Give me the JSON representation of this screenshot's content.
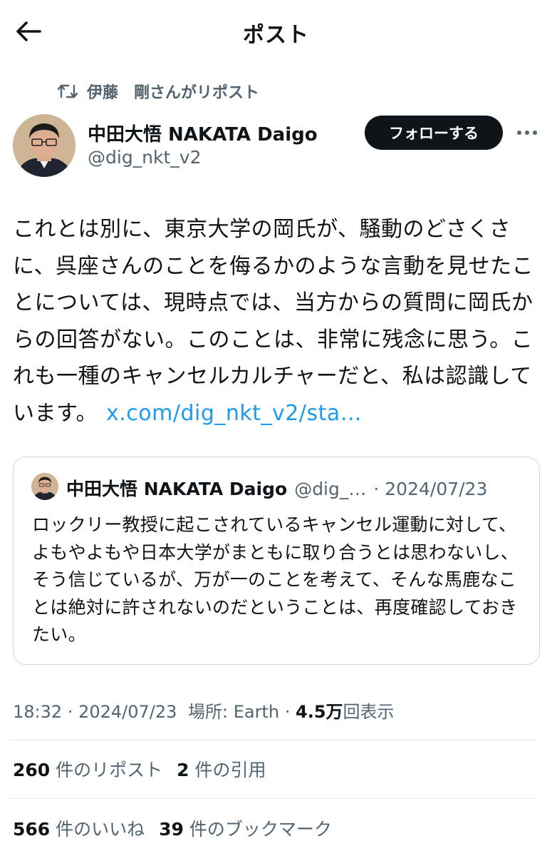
{
  "header": {
    "title": "ポスト"
  },
  "repost": {
    "label": "伊藤　剛さんがリポスト"
  },
  "author": {
    "name": "中田大悟 NAKATA Daigo",
    "handle": "@dig_nkt_v2",
    "follow_label": "フォローする"
  },
  "post": {
    "text": "これとは別に、東京大学の岡氏が、騒動のどさくさに、呉座さんのことを侮るかのような言動を見せたことについては、現時点では、当方からの質問に岡氏からの回答がない。このことは、非常に残念に思う。これも一種のキャンセルカルチャーだと、私は認識しています。",
    "link": "x.com/dig_nkt_v2/sta…"
  },
  "quote": {
    "name": "中田大悟 NAKATA Daigo",
    "handle": "@dig_…",
    "date": "· 2024/07/23",
    "text": "ロックリー教授に起こされているキャンセル運動に対して、よもやよもや日本大学がまともに取り合うとは思わないし、そう信じているが、万が一のことを考えて、そんな馬鹿なことは絶対に許されないのだということは、再度確認しておきたい。"
  },
  "meta": {
    "time": "18:32",
    "date": "2024/07/23",
    "location": "場所: Earth",
    "views_count": "4.5万",
    "views_label": "回表示"
  },
  "stats": {
    "reposts_count": "260",
    "reposts_label": "件のリポスト",
    "quotes_count": "2",
    "quotes_label": "件の引用",
    "likes_count": "566",
    "likes_label": "件のいいね",
    "bookmarks_count": "39",
    "bookmarks_label": "件のブックマーク"
  },
  "icons": {
    "back": "arrow-left-icon",
    "repost": "repost-icon",
    "more": "more-icon"
  },
  "colors": {
    "link": "#1d9bf0",
    "secondary_text": "#536471",
    "primary_text": "#0f1419",
    "button_bg": "#0f1419"
  }
}
